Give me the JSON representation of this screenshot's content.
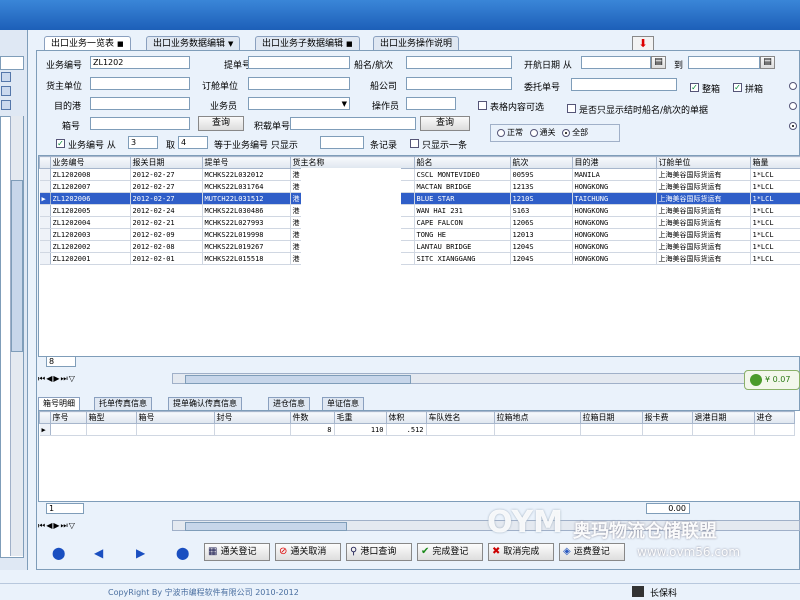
{
  "tabs": [
    {
      "label": "出口业务一览表",
      "close": "■"
    },
    {
      "label": "出口业务数据编辑",
      "close": "▼"
    },
    {
      "label": "出口业务子数据编辑",
      "close": "■"
    },
    {
      "label": "出口业务操作说明",
      "close": ""
    }
  ],
  "form": {
    "business_no_label": "业务编号",
    "business_no_value": "ZL1202",
    "bill_no_label": "提单号",
    "ship_voyage_label": "船名/航次",
    "sailing_date_label": "开航日期 从",
    "to_label": "到",
    "consignor_label": "货主单位",
    "booking_unit_label": "订舱单位",
    "shipping_co_label": "船公司",
    "entrust_no_label": "委托单号",
    "whole_box_label": "整箱",
    "lcl_label": "拼箱",
    "destination_label": "目的港",
    "salesman_label": "业务员",
    "operator_label": "操作员",
    "table_content_label": "表格内容可选",
    "show_ship_only_label": "是否只显示结时船名/航次的单据",
    "box_no_label": "箱号",
    "query_label": "查询",
    "booking_no_label": "积载单号",
    "query2_label": "查询",
    "biz_no_filter_label": "业务编号 从",
    "from_value": "3",
    "take_label": "取",
    "take_value": "4",
    "equal_label": "等于业务编号 只显示",
    "records_label": "条记录",
    "only_one_label": "只显示一条",
    "normal_label": "正常",
    "customs_label": "通关",
    "all_label": "全部"
  },
  "main_grid": {
    "columns": [
      "业务编号",
      "报关日期",
      "提单号",
      "货主名称",
      "船名",
      "航次",
      "目的港",
      "订舱单位",
      "箱量"
    ],
    "rows": [
      [
        "ZL1202008",
        "2012-02-27",
        "MCHKS22L032012",
        "港",
        "",
        "CSCL MONTEVIDEO",
        "0059S",
        "MANILA",
        "上海美谷国际货运有",
        "1*LCL"
      ],
      [
        "ZL1202007",
        "2012-02-27",
        "MCHKS22L031764",
        "港",
        "",
        "MACTAN BRIDGE",
        "1213S",
        "HONGKONG",
        "上海美谷国际货运有",
        "1*LCL"
      ],
      [
        "ZL1202006",
        "2012-02-27",
        "MUTCH22L031512",
        "港",
        "",
        "BLUE STAR",
        "1210S",
        "TAICHUNG",
        "上海美谷国际货运有",
        "1*LCL"
      ],
      [
        "ZL1202005",
        "2012-02-24",
        "MCHKS22L030486",
        "港",
        "",
        "WAN HAI 231",
        "S163",
        "HONGKONG",
        "上海美谷国际货运有",
        "1*LCL"
      ],
      [
        "ZL1202004",
        "2012-02-21",
        "MCHKS22L027993",
        "港",
        "",
        "CAPE FALCON",
        "1206S",
        "HONGKONG",
        "上海美谷国际货运有",
        "1*LCL"
      ],
      [
        "ZL1202003",
        "2012-02-09",
        "MCHKS22L019998",
        "港",
        "",
        "TONG HE",
        "12013",
        "HONGKONG",
        "上海美谷国际货运有",
        "1*LCL"
      ],
      [
        "ZL1202002",
        "2012-02-08",
        "MCHKS22L019267",
        "港",
        "",
        "LANTAU BRIDGE",
        "1204S",
        "HONGKONG",
        "上海美谷国际货运有",
        "1*LCL"
      ],
      [
        "ZL1202001",
        "2012-02-01",
        "MCHKS22L015518",
        "港",
        "",
        "SITC XIANGGANG",
        "1204S",
        "HONGKONG",
        "上海美谷国际货运有",
        "1*LCL"
      ]
    ],
    "selected_row": 2,
    "footer_count": "8"
  },
  "amount_badge": "¥ 0.07",
  "detail_tabs": [
    "箱号明细",
    "托单传真信息",
    "提单确认传真信息",
    "进仓信息",
    "单证信息"
  ],
  "detail_grid": {
    "columns": [
      "序号",
      "箱型",
      "箱号",
      "封号",
      "件数",
      "毛重",
      "体积",
      "车队姓名",
      "拉箱地点",
      "拉箱日期",
      "报卡费",
      "退港日期",
      "进仓"
    ],
    "row": [
      "",
      "",
      "",
      "",
      "8",
      "110",
      ".512",
      "",
      "",
      "",
      "",
      "",
      ""
    ],
    "footer_count": "1",
    "footer_total": "0.00"
  },
  "toolbar": {
    "customs_reg": "通关登记",
    "customs_cancel": "通关取消",
    "port_query": "港口查询",
    "complete_reg": "完成登记",
    "cancel_complete": "取消完成",
    "fee_reg": "运费登记"
  },
  "footer": {
    "copyright": "CopyRight By 宁波市编程软件有限公司 2010-2012",
    "right_label": "长保科"
  },
  "watermark": {
    "title": "奥玛物流仓储联盟",
    "url": "www.ovm56.com"
  },
  "colors": {
    "selection": "#2f5ec8",
    "titlebar": "#1d5fb8",
    "accent_red": "#dd0000"
  }
}
